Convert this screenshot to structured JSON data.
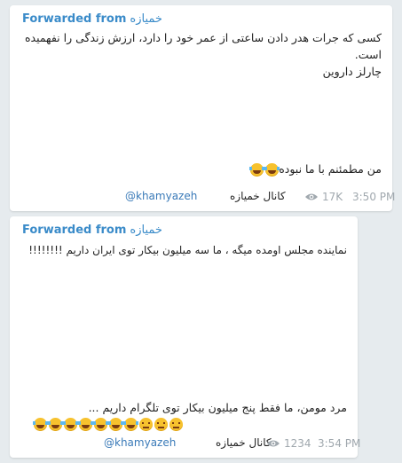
{
  "messages": [
    {
      "forwarded_label": "Forwarded from",
      "forwarded_name": "خمیازه",
      "text_lines": [
        "کسی که جرات هدر دادن ساعتی از عمر خود را دارد، ارزش زندگی را نفهمیده",
        "است.",
        "چارلز داروین"
      ],
      "bottom_text": "من مطمئنم با ما نبوده",
      "emojis": [
        "laugh",
        "laugh"
      ],
      "channel_tag": "@khamyazeh",
      "channel_name": "کانال خمیازه",
      "views": "17K",
      "time": "3:50 PM"
    },
    {
      "forwarded_label": "Forwarded from",
      "forwarded_name": "خمیازه",
      "text_lines": [
        "نماینده مجلس اومده میگه ، ما سه میلیون بیکار توی ایران داریم !!!!!!!!"
      ],
      "bottom_text": "مرد مومن، ما فقط پنج میلیون بیکار توی تلگرام داریم ...",
      "emojis": [
        "laugh",
        "laugh",
        "laugh",
        "laugh",
        "laugh",
        "laugh",
        "laugh",
        "sad",
        "sad",
        "sad"
      ],
      "channel_tag": "@khamyazeh",
      "channel_name": "کانال خمیازه",
      "views": "1234",
      "time": "3:54 PM"
    }
  ],
  "icons": {
    "views": "eye-icon",
    "laugh": "face-with-tears-of-joy-icon",
    "sad": "pensive-face-icon"
  },
  "colors": {
    "background": "#e6ebee",
    "accent": "#3a8bc9",
    "meta": "#a0a8ae"
  }
}
